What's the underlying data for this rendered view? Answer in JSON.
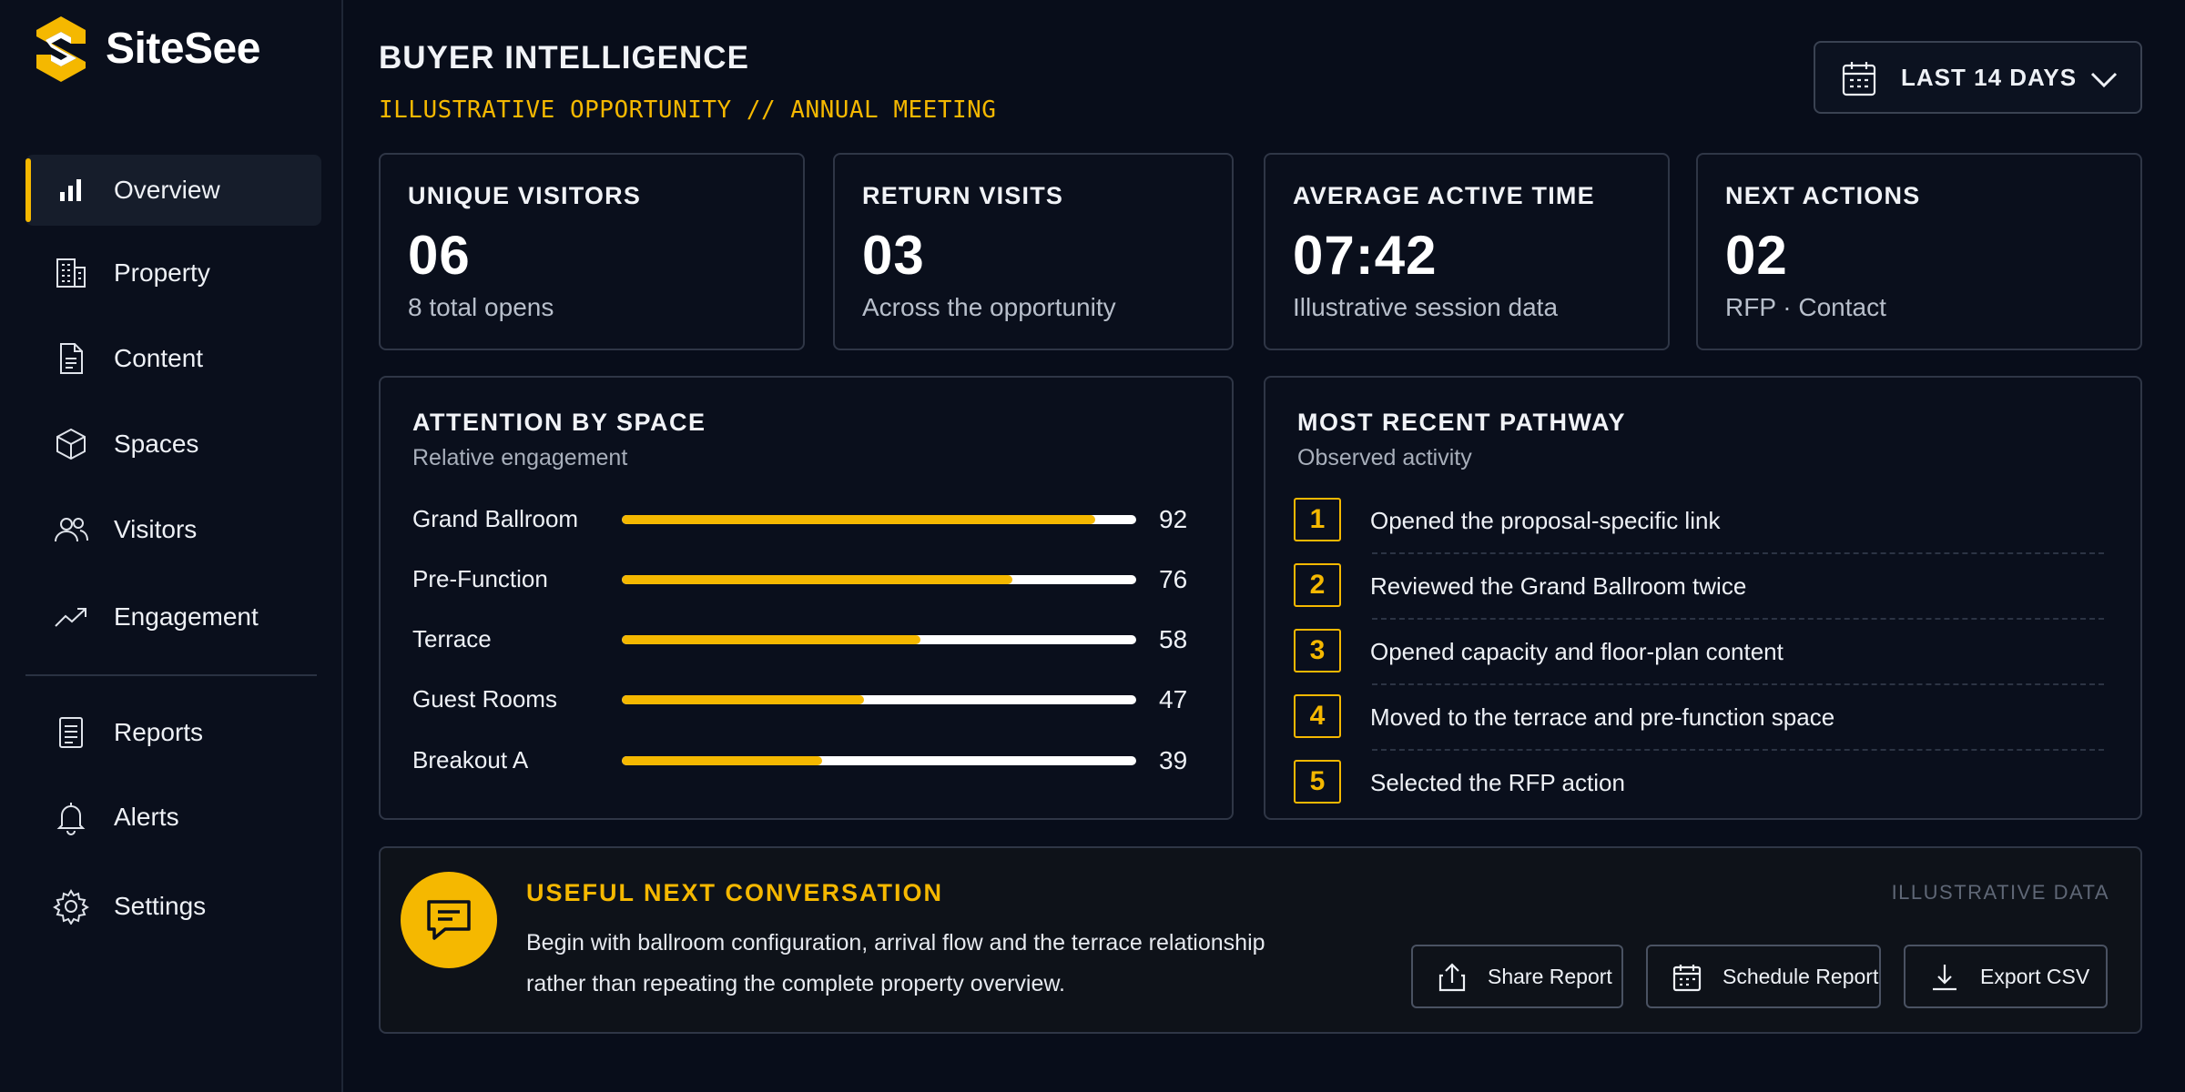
{
  "app": {
    "name": "SiteSee",
    "logo_icon": "sitesee-logo-icon"
  },
  "colors": {
    "accent": "#f5b800",
    "background": "#080d1a",
    "card_border": "#2f3646",
    "bar_track": "#ffffff"
  },
  "sidebar": {
    "items": [
      {
        "label": "Overview",
        "icon": "bar-chart-icon",
        "active": true
      },
      {
        "label": "Property",
        "icon": "building-icon"
      },
      {
        "label": "Content",
        "icon": "document-icon"
      },
      {
        "label": "Spaces",
        "icon": "cube-icon"
      },
      {
        "label": "Visitors",
        "icon": "users-icon"
      },
      {
        "label": "Engagement",
        "icon": "trend-icon"
      },
      {
        "label": "Reports",
        "icon": "report-icon"
      },
      {
        "label": "Alerts",
        "icon": "bell-icon"
      },
      {
        "label": "Settings",
        "icon": "gear-icon"
      }
    ]
  },
  "header": {
    "title": "BUYER INTELLIGENCE",
    "subtitle": "ILLUSTRATIVE OPPORTUNITY // ANNUAL MEETING",
    "date_range": {
      "label": "LAST 14 DAYS",
      "icon": "calendar-icon"
    }
  },
  "stats": [
    {
      "label": "UNIQUE VISITORS",
      "value": "06",
      "note": "8 total opens"
    },
    {
      "label": "RETURN VISITS",
      "value": "03",
      "note": "Across the opportunity"
    },
    {
      "label": "AVERAGE ACTIVE TIME",
      "value": "07:42",
      "note": "Illustrative session data"
    },
    {
      "label": "NEXT ACTIONS",
      "value": "02",
      "note": "RFP · Contact"
    }
  ],
  "attention": {
    "title": "ATTENTION BY SPACE",
    "subtitle": "Relative engagement",
    "max": 100,
    "rows": [
      {
        "label": "Grand Ballroom",
        "value": 92,
        "display": "92"
      },
      {
        "label": "Pre-Function",
        "value": 76,
        "display": "76"
      },
      {
        "label": "Terrace",
        "value": 58,
        "display": "58"
      },
      {
        "label": "Guest Rooms",
        "value": 47,
        "display": "47"
      },
      {
        "label": "Breakout A",
        "value": 39,
        "display": "39"
      }
    ]
  },
  "pathway": {
    "title": "MOST RECENT PATHWAY",
    "subtitle": "Observed activity",
    "steps": [
      {
        "num": "1",
        "text": "Opened the proposal-specific link"
      },
      {
        "num": "2",
        "text": "Reviewed the Grand Ballroom twice"
      },
      {
        "num": "3",
        "text": "Opened capacity and floor-plan content"
      },
      {
        "num": "4",
        "text": "Moved to the terrace and pre-function space"
      },
      {
        "num": "5",
        "text": "Selected the RFP action"
      }
    ]
  },
  "conversation": {
    "icon": "chat-icon",
    "title": "USEFUL NEXT CONVERSATION",
    "text": "Begin with ballroom configuration, arrival flow and the terrace relationship rather than repeating the complete property overview.",
    "tag": "ILLUSTRATIVE DATA",
    "buttons": [
      {
        "label": "Share Report",
        "icon": "share-icon"
      },
      {
        "label": "Schedule Report",
        "icon": "calendar-icon"
      },
      {
        "label": "Export CSV",
        "icon": "download-icon"
      }
    ]
  }
}
